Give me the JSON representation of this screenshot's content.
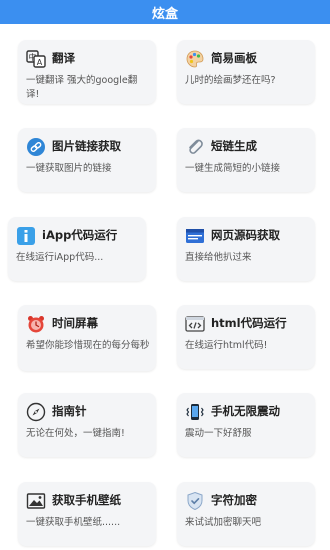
{
  "header": {
    "title": "炫盒"
  },
  "cards": [
    {
      "title": "翻译",
      "desc": "一键翻译 强大的google翻译!",
      "icon": "translate-icon"
    },
    {
      "title": "简易画板",
      "desc": "儿时的绘画梦还在吗?",
      "icon": "palette-icon"
    },
    {
      "title": "图片链接获取",
      "desc": "一键获取图片的链接",
      "icon": "link-icon"
    },
    {
      "title": "短链生成",
      "desc": "一键生成简短的小链接",
      "icon": "paperclip-icon"
    },
    {
      "title": "iApp代码运行",
      "desc": "在线运行iApp代码...",
      "icon": "iapp-icon"
    },
    {
      "title": "网页源码获取",
      "desc": "直接给他扒过来",
      "icon": "webpage-icon"
    },
    {
      "title": "时间屏幕",
      "desc": "希望你能珍惜现在的每分每秒",
      "icon": "alarm-clock-icon"
    },
    {
      "title": "html代码运行",
      "desc": "在线运行html代码!",
      "icon": "code-icon"
    },
    {
      "title": "指南针",
      "desc": "无论在何处，一键指南!",
      "icon": "compass-icon"
    },
    {
      "title": "手机无限震动",
      "desc": "震动一下好舒服",
      "icon": "phone-vibrate-icon"
    },
    {
      "title": "获取手机壁纸",
      "desc": "一键获取手机壁纸......",
      "icon": "wallpaper-icon"
    },
    {
      "title": "字符加密",
      "desc": "来试试加密聊天吧",
      "icon": "shield-icon"
    }
  ]
}
